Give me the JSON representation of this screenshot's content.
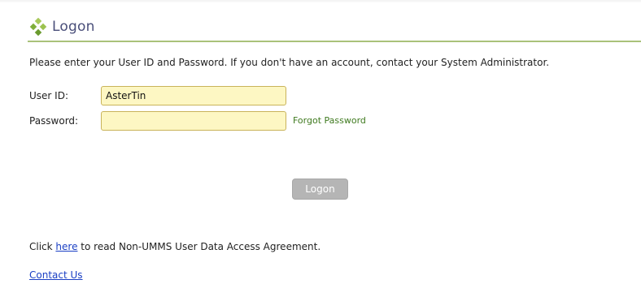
{
  "header": {
    "title": "Logon",
    "logo_icon": "diamond-cluster-icon",
    "title_color": "#4a4f7a",
    "rule_color": "#a9c27a"
  },
  "instructions": "Please enter your User ID and Password. If you don't have an account, contact your System Administrator.",
  "form": {
    "user_id": {
      "label": "User ID:",
      "value": "AsterTin"
    },
    "password": {
      "label": "Password:",
      "value": ""
    },
    "forgot_password_label": "Forgot Password",
    "logon_button_label": "Logon",
    "input_background": "#fdf7c3"
  },
  "agreement": {
    "prefix": "Click ",
    "link_label": "here",
    "suffix": " to read Non-UMMS User Data Access Agreement."
  },
  "contact_us_label": "Contact Us",
  "colors": {
    "link_blue": "#1a3fc4",
    "link_green": "#3f7a1f",
    "button_gray": "#b5b5b5"
  }
}
